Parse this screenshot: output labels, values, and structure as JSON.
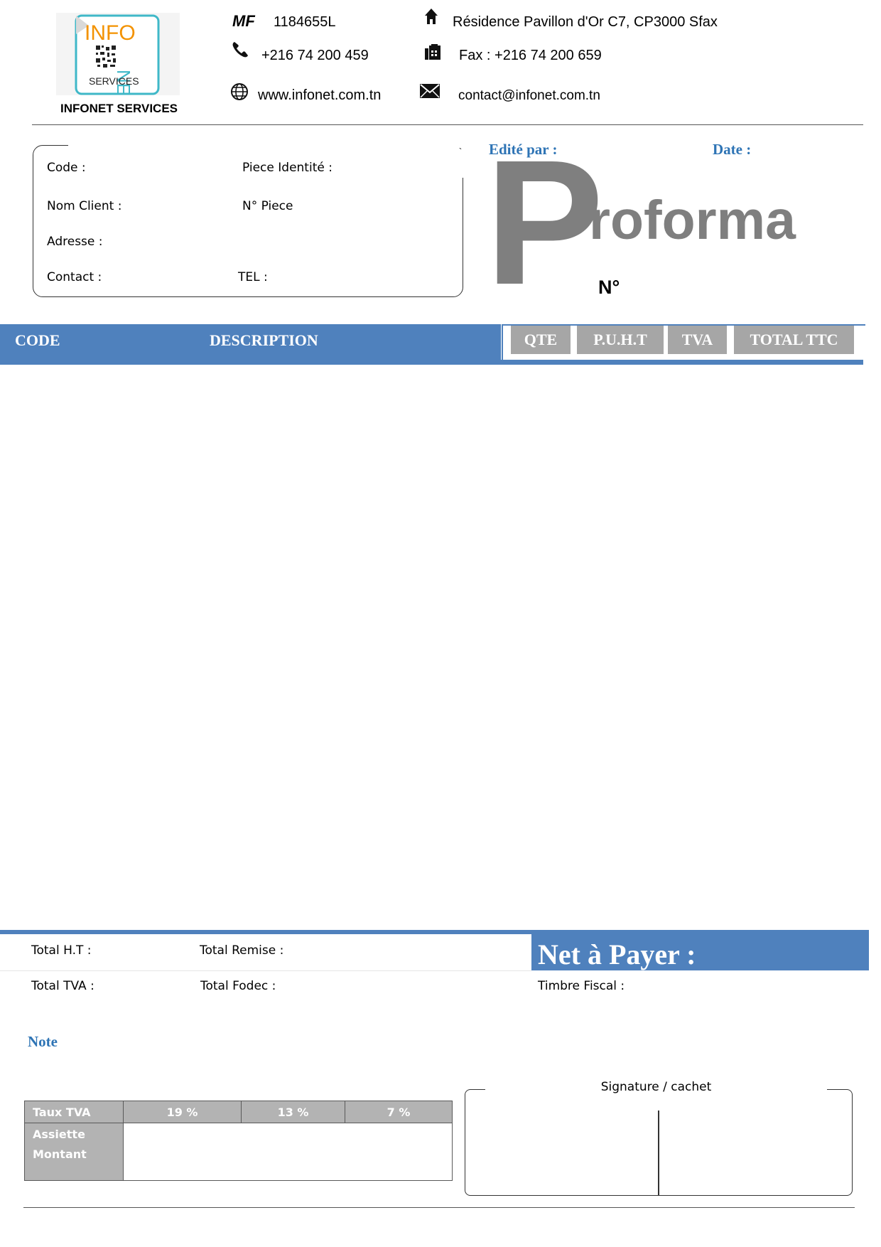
{
  "company": {
    "logo_line1": "INFO",
    "logo_line2": "NET",
    "logo_line3": "SERVICES",
    "name": "INFONET SERVICES"
  },
  "header": {
    "mf_label": "MF",
    "mf_value": "1184655L",
    "address": "Résidence Pavillon d'Or C7, CP3000 Sfax",
    "phone": "+216 74 200 459",
    "fax": "Fax : +216 74 200 659",
    "website": "www.infonet.com.tn",
    "email": "contact@infonet.com.tn"
  },
  "client": {
    "code_label": "Code :",
    "piece_identite_label": "Piece Identité :",
    "nom_client_label": "Nom Client :",
    "num_piece_label": "N° Piece",
    "adresse_label": "Adresse :",
    "contact_label": "Contact :",
    "tel_label": "TEL :"
  },
  "doc": {
    "edited_by_label": "Edité par :",
    "date_label": "Date :",
    "title_initial": "P",
    "title_rest": "roforma",
    "number_label": "N°"
  },
  "table": {
    "columns": [
      "CODE",
      "DESCRIPTION",
      "QTE",
      "P.U.H.T",
      "TVA",
      "TOTAL TTC"
    ],
    "rows": []
  },
  "totals": {
    "total_ht_label": "Total H.T :",
    "total_remise_label": "Total Remise :",
    "net_label": "Net à Payer :",
    "total_tva_label": "Total TVA :",
    "total_fodec_label": "Total Fodec :",
    "timbre_label": "Timbre Fiscal :"
  },
  "note_label": "Note",
  "tva_table": {
    "head_label": "Taux TVA",
    "rates": [
      "19 %",
      "13 %",
      "7 %"
    ],
    "row_labels": [
      "Assiette",
      "Montant"
    ]
  },
  "signature_label": "Signature / cachet",
  "colors": {
    "accent_blue": "#4f81bd",
    "label_blue": "#2e74b5",
    "grey": "#a6a6a6",
    "title_grey": "#7f7f7f"
  }
}
